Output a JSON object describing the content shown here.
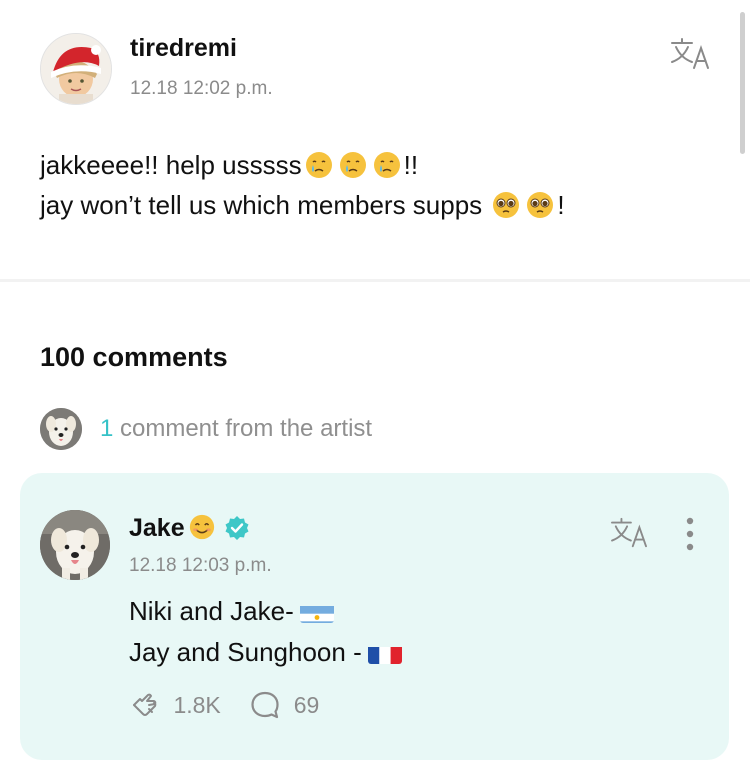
{
  "post": {
    "username": "tiredremi",
    "timestamp": "12.18 12:02 p.m.",
    "translate_icon": "translate-icon",
    "line1_text": "jakkeeee!! help usssss",
    "line1_suffix": "!!",
    "line2_text": "jay won’t tell us which members supps",
    "line2_suffix": "!",
    "line1_emoji": "crying-face-emoji",
    "line2_emoji": "pleading-face-emoji"
  },
  "comments": {
    "title": "100 comments",
    "artist_count": "1",
    "artist_text": "comment from the artist"
  },
  "comment": {
    "author": "Jake",
    "author_emoji": "smiling-face-emoji",
    "verified_icon": "verified-badge-icon",
    "timestamp": "12.18 12:03 p.m.",
    "line1": "Niki and Jake-",
    "line2": "Jay and Sunghoon -",
    "flag1": "argentina-flag",
    "flag2": "france-flag",
    "likes": "1.8K",
    "replies": "69",
    "like_icon": "like-hand-icon",
    "reply_icon": "speech-bubble-icon",
    "more_icon": "more-vertical-icon"
  },
  "colors": {
    "accent": "#35c2c7",
    "card_background": "#e8f8f6",
    "muted_text": "#8b8b8b",
    "verified": "#3ec7c7"
  }
}
